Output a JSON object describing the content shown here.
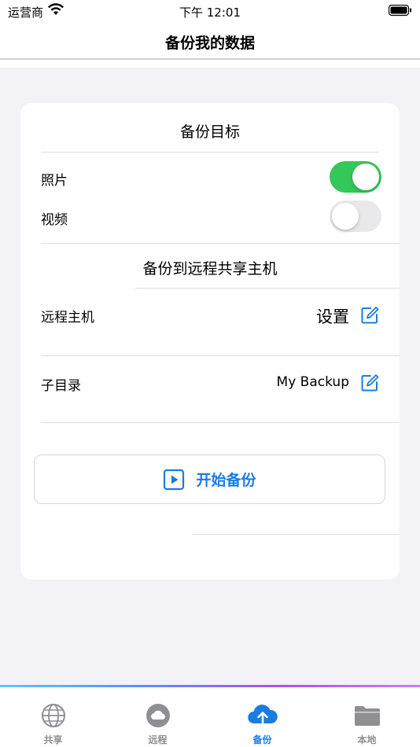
{
  "status_bar": {
    "carrier": "运营商",
    "time": "下午 12:01"
  },
  "nav": {
    "title": "备份我的数据"
  },
  "backup_target": {
    "title": "备份目标",
    "items": [
      {
        "label": "照片",
        "enabled": true
      },
      {
        "label": "视频",
        "enabled": false
      }
    ]
  },
  "remote": {
    "title": "备份到远程共享主机",
    "host": {
      "label": "远程主机",
      "value": "设置"
    },
    "subdir": {
      "label": "子目录",
      "value": "My Backup"
    }
  },
  "start_button": {
    "label": "开始备份"
  },
  "colors": {
    "accent": "#1a7ce0",
    "toggle_on": "#34c759",
    "toggle_off": "#e9e9eb"
  },
  "tabs": [
    {
      "label": "共享",
      "icon": "globe-icon",
      "active": false
    },
    {
      "label": "远程",
      "icon": "cloud-icon",
      "active": false
    },
    {
      "label": "备份",
      "icon": "cloud-upload-icon",
      "active": true
    },
    {
      "label": "本地",
      "icon": "folder-icon",
      "active": false
    }
  ]
}
